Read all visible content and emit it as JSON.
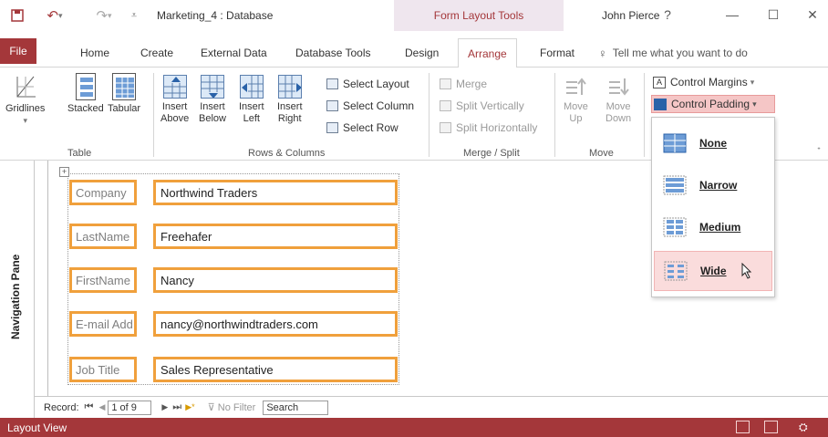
{
  "window": {
    "title": "Marketing_4 : Database",
    "context_tab": "Form Layout Tools",
    "user": "John Pierce",
    "help": "?",
    "minimize": "—",
    "maximize": "☐",
    "close": "✕"
  },
  "tabs": [
    "File",
    "Home",
    "Create",
    "External Data",
    "Database Tools",
    "Design",
    "Arrange",
    "Format"
  ],
  "tell_me": "Tell me what you want to do",
  "ribbon": {
    "table_group": {
      "label": "Table",
      "gridlines": "Gridlines",
      "stacked": "Stacked",
      "tabular": "Tabular"
    },
    "rows_group": {
      "label": "Rows & Columns",
      "insert_above_1": "Insert",
      "insert_above_2": "Above",
      "insert_below_1": "Insert",
      "insert_below_2": "Below",
      "insert_left_1": "Insert",
      "insert_left_2": "Left",
      "insert_right_1": "Insert",
      "insert_right_2": "Right",
      "select_layout": "Select Layout",
      "select_column": "Select Column",
      "select_row": "Select Row"
    },
    "merge_group": {
      "label": "Merge / Split",
      "merge": "Merge",
      "split_vertically": "Split Vertically",
      "split_horizontally": "Split Horizontally"
    },
    "move_group": {
      "label": "Move",
      "move_up_1": "Move",
      "move_up_2": "Up",
      "move_down_1": "Move",
      "move_down_2": "Down"
    },
    "position_group": {
      "control_margins": "Control Margins",
      "control_padding": "Control Padding"
    }
  },
  "padding_menu": {
    "items": [
      "None",
      "Narrow",
      "Medium",
      "Wide"
    ],
    "highlighted": "Wide"
  },
  "navigation_pane": "Navigation Pane",
  "form": {
    "fields": [
      {
        "label": "Company",
        "value": "Northwind Traders"
      },
      {
        "label": "LastName",
        "value": "Freehafer"
      },
      {
        "label": "FirstName",
        "value": "Nancy"
      },
      {
        "label": "E-mail Add",
        "value": "nancy@northwindtraders.com"
      },
      {
        "label": "Job Title",
        "value": "Sales Representative"
      }
    ]
  },
  "record_nav": {
    "label": "Record:",
    "first": "⏮",
    "prev": "◀",
    "position": "1 of 9",
    "next": "▶",
    "last": "⏭",
    "new": "▶*",
    "filter": "No Filter",
    "search": "Search"
  },
  "status": {
    "view": "Layout View"
  },
  "colors": {
    "accent": "#a4373a",
    "control_border": "#f0a03c",
    "highlight": "#fadcdc"
  }
}
